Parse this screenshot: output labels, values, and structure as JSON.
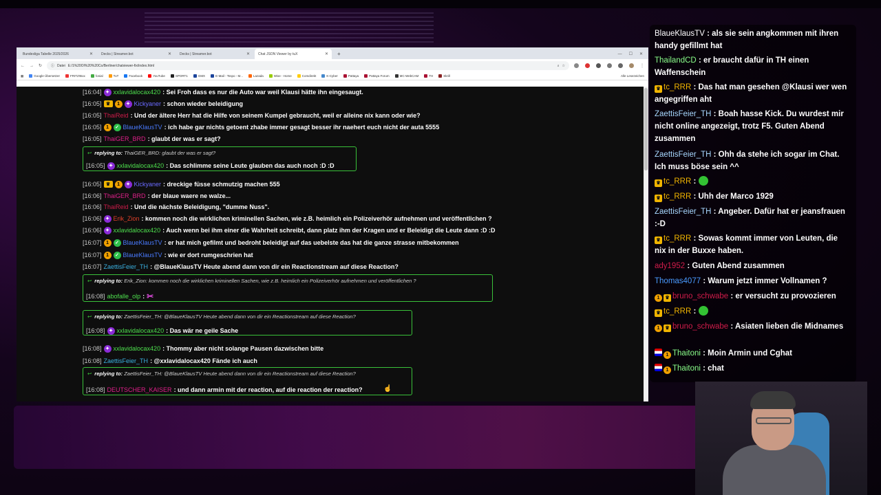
{
  "browser": {
    "tabs": [
      {
        "label": "Bundesliga Tabelle 2025/2026",
        "active": false
      },
      {
        "label": "Decks | Streamer.bot",
        "active": false
      },
      {
        "label": "Decks | Streamer.bot",
        "active": false
      },
      {
        "label": "Chat JSON Viewer by tuX",
        "active": true
      }
    ],
    "address_prefix": "Datei",
    "address_url": "E:/1%20OI%20%20Co/Berliner/chatviewer-fix/index.html",
    "bookmarks": [
      "Google Übersetzer",
      "FRITZ!Box",
      "fonial",
      "TuT",
      "Facebook",
      "YouTube",
      "SPORT1",
      "GMX",
      "E-Mail - Tsspo - M...",
      "Lazada",
      "Wise - Home",
      "Comdirekt",
      "K-Cyber",
      "Pattaya",
      "Pattaya Forum",
      "MC-WebCAM",
      "TH",
      "Skrill",
      "Alle Lesezeichen"
    ]
  },
  "chat": [
    {
      "ts": "[16:04]",
      "badges": [
        "kick"
      ],
      "user": "xxlavidalocax420",
      "color": "#4ee04e",
      "text": ": Sei Froh dass es nur die Auto war weil Klausi hätte ihn eingesaugt."
    },
    {
      "ts": "[16:05]",
      "badges": [
        "crown",
        "one",
        "kick"
      ],
      "user": "Kickyaner",
      "color": "#6a6aff",
      "text": ": schon wieder beleidigung"
    },
    {
      "ts": "[16:05]",
      "badges": [],
      "user": "ThaiReid",
      "color": "#d01c4a",
      "text": ": Und der ältere Herr hat die Hilfe von seinem Kumpel gebraucht, weil er alleine nix kann oder wie?"
    },
    {
      "ts": "[16:05]",
      "badges": [
        "one",
        "verify"
      ],
      "user": "BlaueKlausTV",
      "color": "#4a7bff",
      "text": ": ich habe gar nichts getoent zhabe immer gesagt besser ihr naehert euch nicht der auta 5555"
    },
    {
      "ts": "[16:05]",
      "badges": [],
      "user": "ThaiGER_BRD",
      "color": "#e0208a",
      "text": ": glaubt der was er sagt?"
    },
    {
      "ts": "[16:05]",
      "badges": [
        "kick"
      ],
      "user": "xxlavidalocax420",
      "color": "#4ee04e",
      "text": ": Das schlimme seine Leute glauben das auch noch :D :D",
      "reply": {
        "label": "replying to:",
        "ref": "ThaiGER_BRD: glaubt der was er sagt?"
      }
    },
    {
      "ts": "[16:05]",
      "badges": [
        "crown",
        "one",
        "kick"
      ],
      "user": "Kickyaner",
      "color": "#6a6aff",
      "text": ": dreckige füsse schmutzig machen 555"
    },
    {
      "ts": "[16:06]",
      "badges": [],
      "user": "ThaiGER_BRD",
      "color": "#e0208a",
      "text": ": der blaue waere ne walze..."
    },
    {
      "ts": "[16:06]",
      "badges": [],
      "user": "ThaiReid",
      "color": "#d01c4a",
      "text": ": Und die nächste Beleidigung, \"dumme Nuss\"."
    },
    {
      "ts": "[16:06]",
      "badges": [
        "kick"
      ],
      "user": "Erik_Zion",
      "color": "#e0402a",
      "text": ": kommen noch die wirklichen kriminellen Sachen, wie z.B. heimlich ein Polizeiverhör aufnehmen und veröffentlichen ?"
    },
    {
      "ts": "[16:06]",
      "badges": [
        "kick"
      ],
      "user": "xxlavidalocax420",
      "color": "#4ee04e",
      "text": ": Auch wenn bei ihm einer die Wahrheit schreibt, dann platz ihm der Kragen und er Beleidigt die Leute dann :D :D"
    },
    {
      "ts": "[16:07]",
      "badges": [
        "one",
        "verify"
      ],
      "user": "BlaueKlausTV",
      "color": "#4a7bff",
      "text": ": er hat mich gefilmt und bedroht beleidigt auf das uebelste das hat die ganze strasse mitbekommen"
    },
    {
      "ts": "[16:07]",
      "badges": [
        "one",
        "verify"
      ],
      "user": "BlaueKlausTV",
      "color": "#4a7bff",
      "text": ": wie er dort rumgeschrien hat"
    },
    {
      "ts": "[16:07]",
      "badges": [],
      "user": "ZaettisFeier_TH",
      "color": "#3ab0e0",
      "text": ": @BlaueKlausTV Heute abend dann von dir ein Reactionstream auf diese Reaction?"
    },
    {
      "ts": "[16:08]",
      "badges": [],
      "user": "abofalle_olp",
      "color": "#4ee04e",
      "text": ":",
      "emote": "✂",
      "reply": {
        "label": "replying to:",
        "ref": "Erik_Zion: kommen noch die wirklichen kriminellen Sachen, wie z.B. heimlich ein Polizeiverhör aufnehmen und veröffentlichen ?"
      }
    },
    {
      "ts": "[16:08]",
      "badges": [
        "kick"
      ],
      "user": "xxlavidalocax420",
      "color": "#4ee04e",
      "text": ": Das wär ne geile Sache",
      "reply": {
        "label": "replying to:",
        "ref": "ZaettisFeier_TH: @BlaueKlausTV Heute abend dann von dir ein Reactionstream auf diese Reaction?"
      }
    },
    {
      "ts": "[16:08]",
      "badges": [
        "kick"
      ],
      "user": "xxlavidalocax420",
      "color": "#4ee04e",
      "text": ": Thommy aber nicht solange Pausen dazwischen bitte"
    },
    {
      "ts": "[16:08]",
      "badges": [],
      "user": "ZaettisFeier_TH",
      "color": "#3ab0e0",
      "text": ": @xxlavidalocax420 Fände ich auch"
    },
    {
      "ts": "[16:08]",
      "badges": [],
      "user": "DEUTSCHER_KAISER",
      "color": "#e0208a",
      "text": ": und dann armin mit der reaction, auf die reaction der reaction?",
      "reply": {
        "label": "replying to:",
        "ref": "ZaettisFeier_TH: @BlaueKlausTV Heute abend dann von dir ein Reactionstream auf diese Reaction?"
      }
    }
  ],
  "overlay": [
    {
      "badges": [],
      "user": "BlaueKlausTV",
      "color": "#ffffff",
      "text": ": als sie sein angkommen mit ihren handy gefillmt hat"
    },
    {
      "badges": [],
      "user": "ThailandCD",
      "color": "#8aff8a",
      "text": ": er braucht dafür in TH einen Waffenschein"
    },
    {
      "badges": [
        "crown"
      ],
      "user": "tc_RRR",
      "color": "#f0b400",
      "text": ": Das hat man gesehen @Klausi wer wen angegriffen aht"
    },
    {
      "badges": [],
      "user": "ZaettisFeier_TH",
      "color": "#a8d8ff",
      "text": ": Boah hasse Kick. Du wurdest mir nicht online angezeigt, trotz F5. Guten Abend zusammen"
    },
    {
      "badges": [],
      "user": "ZaettisFeier_TH",
      "color": "#a8d8ff",
      "text": ": Ohh da stehe ich sogar im Chat. Ich muss böse sein ^^"
    },
    {
      "badges": [
        "crown"
      ],
      "user": "tc_RRR",
      "color": "#f0b400",
      "text": ":",
      "emote": true
    },
    {
      "badges": [
        "crown"
      ],
      "user": "tc_RRR",
      "color": "#f0b400",
      "text": ": Uhh der Marco 1929"
    },
    {
      "badges": [],
      "user": "ZaettisFeier_TH",
      "color": "#a8d8ff",
      "text": ": Angeber. Dafür hat er jeansfrauen :-D"
    },
    {
      "badges": [
        "crown"
      ],
      "user": "tc_RRR",
      "color": "#f0b400",
      "text": ": Sowas kommt immer von Leuten, die nix in der Buxxe haben."
    },
    {
      "badges": [],
      "user": "ady1952",
      "color": "#d01c4a",
      "text": ": Guten Abend zusammen"
    },
    {
      "badges": [],
      "user": "Thomas4077",
      "color": "#4a9bff",
      "text": ": Warum jetzt immer Vollnamen ?"
    },
    {
      "badges": [
        "one",
        "crown"
      ],
      "user": "bruno_schwabe",
      "color": "#d01c4a",
      "text": ": er versucht zu provozieren"
    },
    {
      "badges": [
        "crown"
      ],
      "user": "tc_RRR",
      "color": "#f0b400",
      "text": ":",
      "emote": true
    },
    {
      "badges": [
        "one",
        "crown"
      ],
      "user": "bruno_schwabe",
      "color": "#d01c4a",
      "text": ": Asiaten lieben die Midnames"
    },
    {
      "badges": [
        "flag",
        "one"
      ],
      "user": "Thaitoni",
      "color": "#8aff8a",
      "text": ": Moin Armin und Cghat"
    },
    {
      "badges": [
        "flag",
        "one"
      ],
      "user": "Thaitoni",
      "color": "#8aff8a",
      "text": ": chat"
    }
  ]
}
